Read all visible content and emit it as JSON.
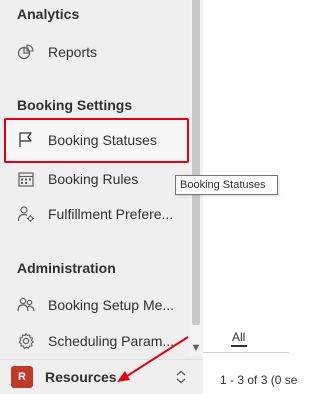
{
  "sidebar": {
    "sections": [
      {
        "title": "Analytics",
        "items": [
          {
            "label": "Reports",
            "icon": "reports-icon"
          }
        ]
      },
      {
        "title": "Booking Settings",
        "items": [
          {
            "label": "Booking Statuses",
            "icon": "flag-icon",
            "selected": true
          },
          {
            "label": "Booking Rules",
            "icon": "calendar-icon"
          },
          {
            "label": "Fulfillment Prefere...",
            "icon": "fulfillment-icon"
          }
        ]
      },
      {
        "title": "Administration",
        "items": [
          {
            "label": "Booking Setup Me...",
            "icon": "people-icon"
          },
          {
            "label": "Scheduling Param...",
            "icon": "gear-icon"
          }
        ]
      }
    ],
    "area_switcher": {
      "badge": "R",
      "label": "Resources",
      "badge_color": "#c0392b"
    }
  },
  "tooltip": "Booking Statuses",
  "main": {
    "tab_all": "All",
    "pager": "1 - 3 of 3 (0 se"
  },
  "colors": {
    "highlight": "#e3000f",
    "sidebar_bg": "#efefef"
  }
}
